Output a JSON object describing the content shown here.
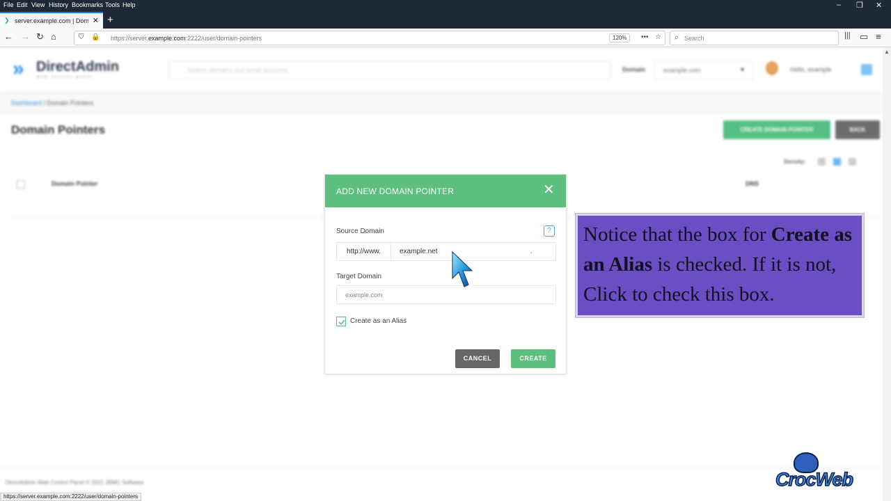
{
  "browser": {
    "menu": [
      "File",
      "Edit",
      "View",
      "History",
      "Bookmarks",
      "Tools",
      "Help"
    ],
    "tab_title": "server.example.com | Domain P",
    "url_prefix": "https://server.",
    "url_host": "example.com",
    "url_rest": ":2222/user/domain-pointers",
    "zoom": "120%",
    "search_placeholder": "Search",
    "status_url": "https://server.example.com:2222/user/domain-pointers"
  },
  "header": {
    "logo_name": "DirectAdmin",
    "logo_tag": "web control panel",
    "search_placeholder": "Search domains and email accounts",
    "domain_label": "Domain",
    "domain_value": "example.com",
    "hello": "Hello, example"
  },
  "breadcrumb": {
    "link": "Dashboard",
    "sep": " / ",
    "current": "Domain Pointers"
  },
  "page": {
    "title": "Domain Pointers",
    "create_button": "CREATE DOMAIN POINTER",
    "back_button": "BACK",
    "density_label": "Density:",
    "col_pointer": "Domain Pointer",
    "col_dns": "DNS",
    "footer": "DirectAdmin Web Control Panel © 2021 JBMC Software"
  },
  "modal": {
    "title": "ADD NEW DOMAIN POINTER",
    "source_label": "Source Domain",
    "source_prefix": "http://www.",
    "source_value": "example.net",
    "target_label": "Target Domain",
    "target_placeholder": "example.com",
    "alias_label": "Create as an Alias",
    "alias_checked": true,
    "cancel": "CANCEL",
    "create": "CREATE"
  },
  "annotation": {
    "t1": "Notice that the box for ",
    "t2": "Create as an Alias",
    "t3": " is checked. If it is not, Click to check this box."
  },
  "watermark": "CrocWeb",
  "colors": {
    "accent_green": "#5dbf7d",
    "accent_blue": "#2e8fe6",
    "note_bg": "#6b4ec4"
  }
}
